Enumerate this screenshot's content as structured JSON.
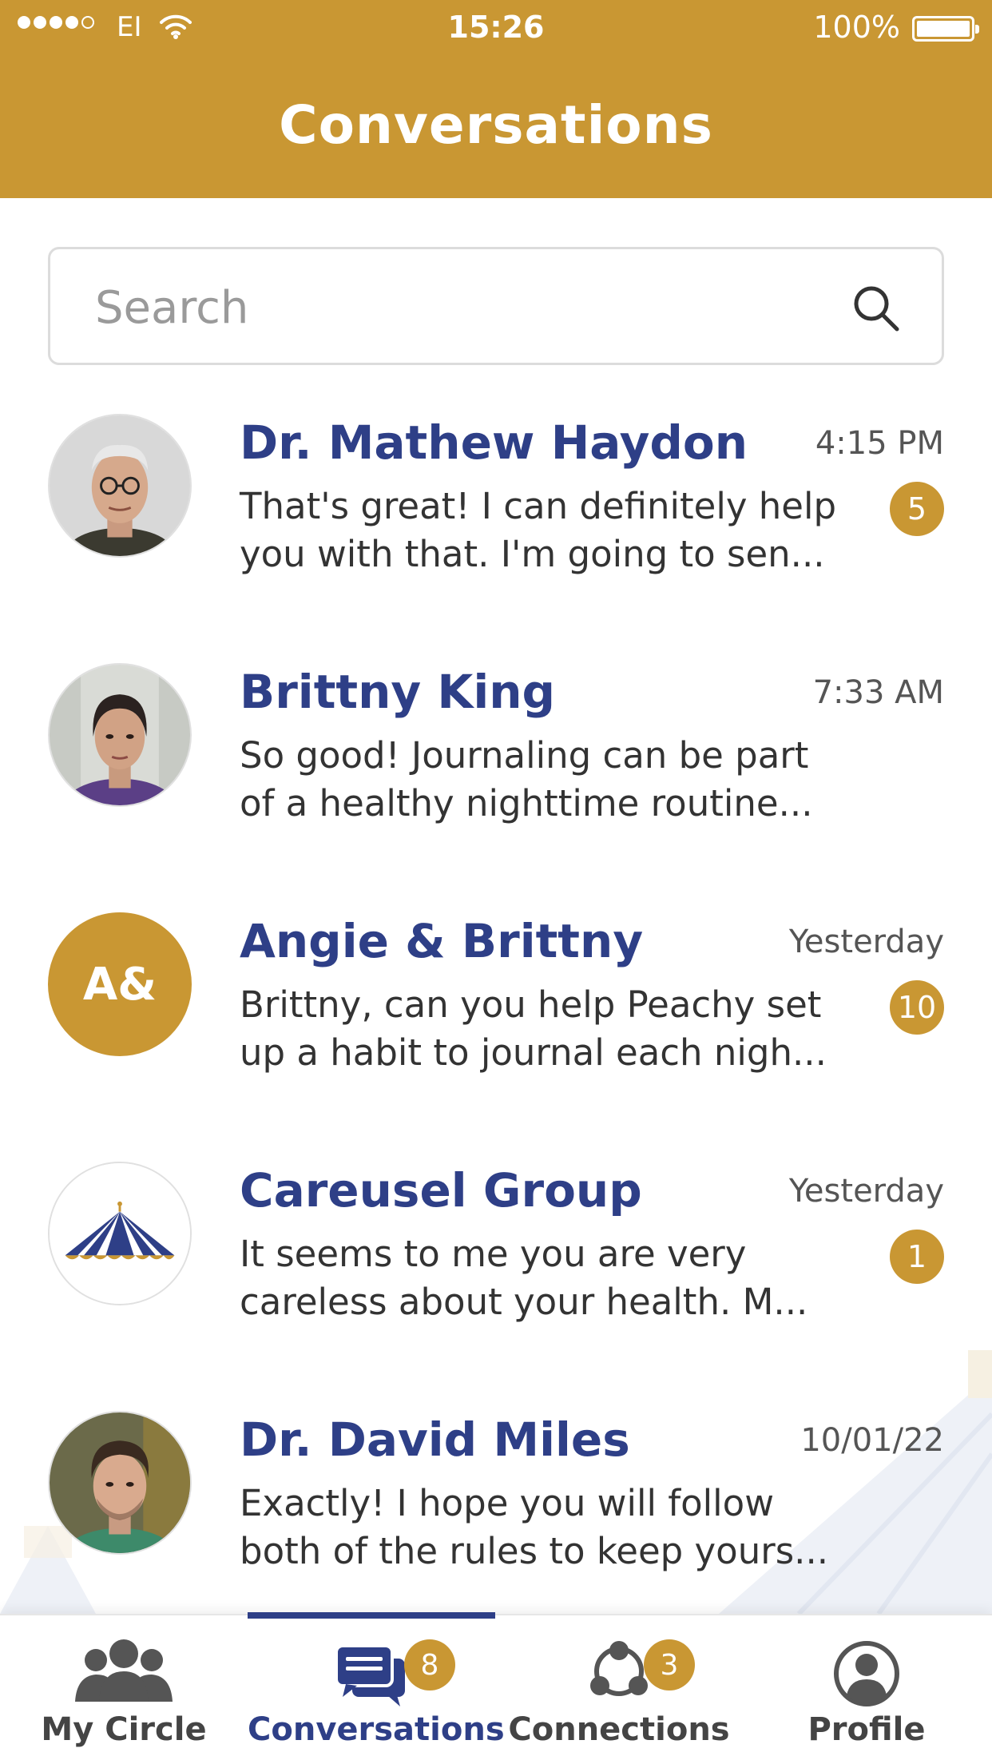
{
  "status_bar": {
    "carrier": "EI",
    "time": "15:26",
    "battery": "100%"
  },
  "header": {
    "title": "Conversations"
  },
  "search": {
    "placeholder": "Search",
    "value": ""
  },
  "conversations": [
    {
      "name": "Dr. Mathew Haydon",
      "time": "4:15 PM",
      "preview_line1": "That's great! I can definitely help",
      "preview_line2": "you with that. I'm going to sen...",
      "unread": "5"
    },
    {
      "name": "Brittny King",
      "time": "7:33 AM",
      "preview_line1": "So good! Journaling can be part",
      "preview_line2": "of a healthy nighttime routine...",
      "unread": ""
    },
    {
      "name": "Angie & Brittny",
      "time": "Yesterday",
      "avatar_initials": "A&",
      "preview_line1": "Brittny, can you help Peachy set",
      "preview_line2": "up a habit to journal each nigh...",
      "unread": "10"
    },
    {
      "name": "Careusel Group",
      "time": "Yesterday",
      "preview_line1": "It seems to me you are very",
      "preview_line2": "careless about your health. M...",
      "unread": "1"
    },
    {
      "name": "Dr. David Miles",
      "time": "10/01/22",
      "preview_line1": "Exactly! I hope you will follow",
      "preview_line2": "both of the rules to keep yours...",
      "unread": ""
    }
  ],
  "tabbar": {
    "tabs": [
      {
        "label": "My Circle",
        "icon": "group-icon",
        "active": false,
        "badge": ""
      },
      {
        "label": "Conversations",
        "icon": "chat-icon",
        "active": true,
        "badge": "8"
      },
      {
        "label": "Connections",
        "icon": "connections-icon",
        "active": false,
        "badge": "3"
      },
      {
        "label": "Profile",
        "icon": "profile-icon",
        "active": false,
        "badge": ""
      }
    ]
  },
  "colors": {
    "brand_gold": "#c99733",
    "brand_navy": "#2e3f87",
    "header_text": "#ffffff"
  }
}
